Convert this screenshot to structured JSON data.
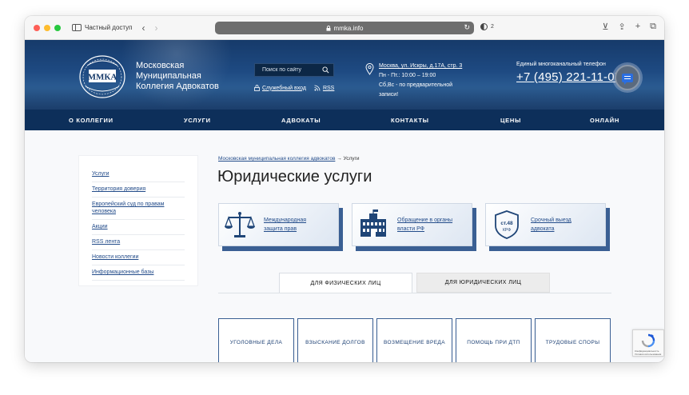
{
  "browser": {
    "private_label": "Частный доступ",
    "url": "mmka.info",
    "tracker_count": "2"
  },
  "header": {
    "logo_text": "ММКА",
    "brand_lines": [
      "Московская",
      "Муниципальная",
      "Коллегия Адвокатов"
    ],
    "search_placeholder": "Поиск по сайту",
    "service_login": "Служебный вход",
    "rss": "RSS",
    "address_line": "Москва, ул. Искры, д.17А, стр. 3",
    "hours_line1": "Пн - Пт.: 10:00 – 19:00",
    "hours_line2": "Сб,Вс - по предварительной",
    "hours_line3": "записи!",
    "phone_caption": "Единый многоканальный телефон",
    "phone_number": "+7 (495) 221-11-07"
  },
  "nav": [
    "О КОЛЛЕГИИ",
    "УСЛУГИ",
    "АДВОКАТЫ",
    "КОНТАКТЫ",
    "ЦЕНЫ",
    "ОНЛАЙН"
  ],
  "sidebar": [
    "Услуги",
    "Территория доверия",
    "Европейский суд по правам человека",
    "Акции",
    "RSS лента",
    "Новости коллегии",
    "Информационные базы"
  ],
  "breadcrumb": {
    "link": "Московская муниципальная коллегия адвокатов",
    "separator": "→",
    "current": "Услуги"
  },
  "page_title": "Юридические услуги",
  "cards": [
    {
      "label_line1": "Международная",
      "label_line2": "защита прав",
      "icon": "scales-icon"
    },
    {
      "label_line1": "Обращение в органы",
      "label_line2": "власти РФ",
      "icon": "government-building-icon"
    },
    {
      "label_line1": "Срочный выезд",
      "label_line2": "адвоката",
      "icon": "badge-icon",
      "badge_line1": "ст.48",
      "badge_line2": "КРФ"
    }
  ],
  "tabs": {
    "individuals": "ДЛЯ ФИЗИЧЕСКИХ ЛИЦ",
    "companies": "ДЛЯ ЮРИДИЧЕСКИХ ЛИЦ"
  },
  "services": [
    "УГОЛОВНЫЕ ДЕЛА",
    "ВЗЫСКАНИЕ ДОЛГОВ",
    "ВОЗМЕЩЕНИЕ ВРЕДА",
    "ПОМОЩЬ ПРИ ДТП",
    "ТРУДОВЫЕ СПОРЫ"
  ],
  "recaptcha": {
    "line1": "Конфиденциальность",
    "line2": "Условия использования"
  }
}
